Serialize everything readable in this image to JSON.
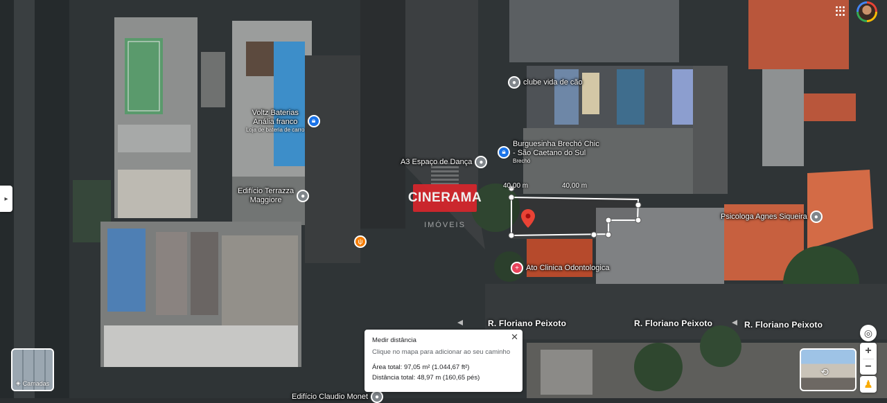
{
  "map": {
    "street_labels": [
      "R. Floriano Peixoto",
      "R. Floriano Peixoto",
      "R. Floriano Peixoto"
    ],
    "places": [
      {
        "name": "Voltz Baterias\nAnália franco",
        "sub": "Loja de bateria de carro",
        "icon": "shopping-bag-icon",
        "color": "#1a73e8"
      },
      {
        "name": "Edifício Terrazza\nMaggiore",
        "sub": "",
        "icon": "pin-icon",
        "color": "#80868b"
      },
      {
        "name": "clube vida de cão",
        "sub": "",
        "icon": "pin-icon",
        "color": "#80868b"
      },
      {
        "name": "Burguesinha Brechó Chic\n- São Caetano do Sul",
        "sub": "Brechó",
        "icon": "shopping-bag-icon",
        "color": "#1a73e8"
      },
      {
        "name": "A3 Espaço de Dança",
        "sub": "",
        "icon": "pin-icon",
        "color": "#80868b"
      },
      {
        "name": "Psicologa Agnes Siqueira",
        "sub": "",
        "icon": "pin-icon",
        "color": "#80868b"
      },
      {
        "name": "Ato Clinica Odontologica",
        "sub": "",
        "icon": "medical-icon",
        "color": "#e8435a"
      },
      {
        "name": "Edifício Claudio Monet",
        "sub": "",
        "icon": "pin-icon",
        "color": "#80868b"
      },
      {
        "name": "",
        "sub": "",
        "icon": "restaurant-icon",
        "color": "#f57c00"
      }
    ],
    "measure_labels": [
      "40,00 m",
      "40,00 m"
    ],
    "watermark": {
      "brand": "CINERAMA",
      "sub": "IMÓVEIS"
    }
  },
  "layers_button": {
    "label": "Camadas",
    "icon": "layers-icon"
  },
  "measure_card": {
    "title": "Medir distância",
    "subtitle": "Clique no mapa para adicionar ao seu caminho",
    "area": "Área total: 97,05 m² (1.044,67 ft²)",
    "distance": "Distância total: 48,97 m (160,65 pés)",
    "close": "✕"
  },
  "controls": {
    "zoom_in": "+",
    "zoom_out": "−",
    "location": "my-location-icon",
    "pegman": "pegman-icon"
  },
  "side_tab": "▸",
  "colors": {
    "accent": "#1a73e8",
    "pin_red": "#ea4335",
    "medical": "#e8435a"
  }
}
